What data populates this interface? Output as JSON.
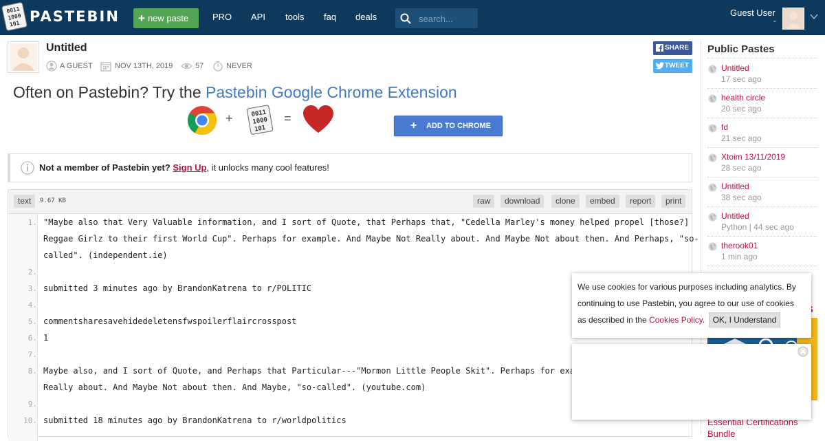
{
  "header": {
    "logo_text": "PASTEBIN",
    "new_paste_label": "new paste",
    "nav": [
      "PRO",
      "API",
      "tools",
      "faq",
      "deals"
    ],
    "search_placeholder": "search...",
    "user_name": "Guest User",
    "user_sub": "-"
  },
  "paste": {
    "title": "Untitled",
    "author": "A GUEST",
    "date": "NOV 13TH, 2019",
    "views": "57",
    "expires": "NEVER",
    "share_label": "SHARE",
    "tweet_label": "TWEET"
  },
  "promo": {
    "prefix": "Often on Pastebin? Try the ",
    "link": "Pastebin Google Chrome Extension",
    "plus": "+",
    "equals": "=",
    "button_label": "ADD TO CHROME"
  },
  "notice": {
    "bold": "Not a member of Pastebin yet?",
    "signup": "Sign Up",
    "rest": ", it unlocks many cool features!"
  },
  "code": {
    "syntax": "text",
    "size": "9.67 KB",
    "toolbar": [
      "raw",
      "download",
      "clone",
      "embed",
      "report",
      "print"
    ],
    "line_numbers": [
      "1.",
      "2.",
      "3.",
      "4.",
      "5.",
      "6.",
      "7.",
      "8.",
      "9.",
      "10."
    ],
    "lines": [
      "\"Maybe also that Very Valuable information, and I sort of Quote, that Perhaps that, \"Cedella Marley's money helped propel [those?]",
      "Reggae Girlz to their first World Cup\". Perhaps for example. And Maybe Not Really about. And Maybe Not about then. And Perhaps, \"so-",
      "called\". (independent.ie)",
      "submitted 3 minutes ago by BrandonKatrena to r/POLITIC",
      "commentsharesavehidedeletensfwspoilerflaircrosspost",
      "1",
      "Maybe also, and I sort of Quote, and Perhaps that Particular---\"Mormon Little People Skit\". Perhaps for exampl",
      "Really about. And Maybe Not about then. And Maybe, \"so-called\". (youtube.com)",
      "submitted 18 minutes ago by BrandonKatrena to r/worldpolitics"
    ]
  },
  "sidebar": {
    "title": "Public Pastes",
    "items": [
      {
        "name": "Untitled",
        "time": "17 sec ago"
      },
      {
        "name": "health circle",
        "time": "20 sec ago"
      },
      {
        "name": "fd",
        "time": "21 sec ago"
      },
      {
        "name": "Xtoim 13/11/2019",
        "time": "28 sec ago"
      },
      {
        "name": "Untitled",
        "time": "38 sec ago"
      },
      {
        "name": "Untitled",
        "time": "Python | 44 sec ago"
      },
      {
        "name": "therook01",
        "time": "1 min ago"
      }
    ],
    "ad_title": "Essential Certifications",
    "ad_title2": "Bundle",
    "ad_side_text": "S"
  },
  "cookie": {
    "text": "We use cookies for various purposes including analytics. By continuing to use Pastebin, you agree to our use of cookies as described in the ",
    "link": "Cookies Policy",
    "period": ".",
    "ok_label": "OK, I Understand"
  },
  "colors": {
    "header_bg": "#0d3a5c",
    "new_paste_green": "#53a754",
    "accent_red": "#c0123f",
    "link_blue": "#3f7bc0",
    "chrome_button": "#4a7bd2"
  }
}
